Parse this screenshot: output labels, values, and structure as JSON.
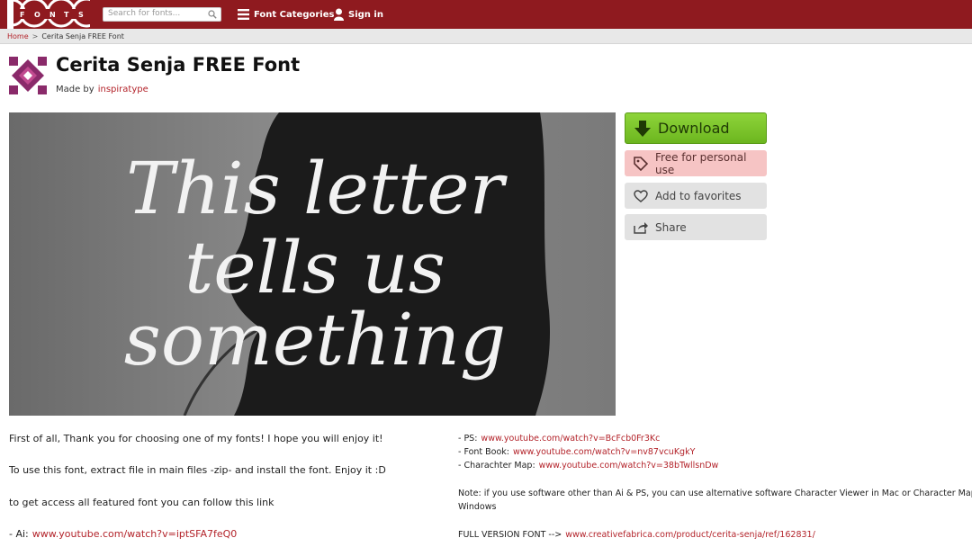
{
  "header": {
    "logo_letters": [
      "F",
      "O",
      "N",
      "T",
      "S"
    ],
    "search_placeholder": "Search for fonts...",
    "font_categories_label": "Font Categories",
    "sign_in_label": "Sign in",
    "brand_color": "#8f1a1f"
  },
  "breadcrumb": {
    "home": "Home",
    "separator": ">",
    "current": "Cerita Senja FREE Font"
  },
  "font": {
    "title": "Cerita Senja FREE Font",
    "made_by_label": "Made by",
    "author": "inspiratype"
  },
  "preview": {
    "lines": [
      "This letter",
      "tells us",
      "something"
    ]
  },
  "actions": {
    "download": "Download",
    "license": "Free for personal use",
    "favorites": "Add to favorites",
    "share": "Share"
  },
  "description": {
    "left": {
      "p1": "First of all, Thank you for choosing one of my fonts! I hope you will enjoy it!",
      "p2": "To use this font, extract file in main files -zip- and install the font. Enjoy it :D",
      "p3": "to get access all featured font you can follow this link",
      "ai_label": "- Ai:",
      "ai_url": "www.youtube.com/watch?v=iptSFA7feQ0"
    },
    "right": {
      "ps_label": "- PS:",
      "ps_url": "www.youtube.com/watch?v=BcFcb0Fr3Kc",
      "fontbook_label": "- Font Book:",
      "fontbook_url": "www.youtube.com/watch?v=nv87vcuKgkY",
      "charmap_label": "- Charachter Map:",
      "charmap_url": "www.youtube.com/watch?v=38bTwllsnDw",
      "note_line1": "Note: if you use software other than Ai & PS, you can use alternative software Character Viewer in Mac or Character Map in",
      "note_line2": "Windows",
      "full_label": "FULL VERSION FONT -->",
      "full_url": "www.creativefabrica.com/product/cerita-senja/ref/162831/"
    }
  }
}
